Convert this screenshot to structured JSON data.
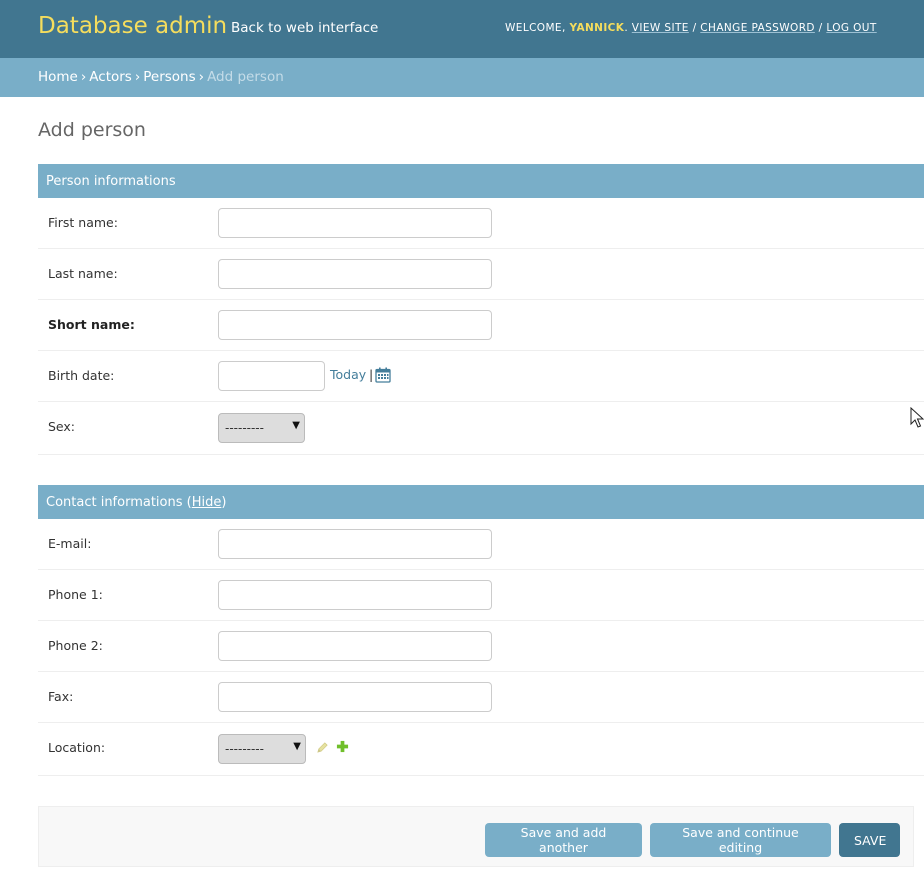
{
  "header": {
    "branding": "Database admin",
    "back_link": "Back to web interface",
    "welcome": "Welcome,",
    "username": "Yannick",
    "view_site": "View site",
    "change_password": "Change password",
    "log_out": "Log out",
    "separator": "/"
  },
  "breadcrumbs": {
    "home": "Home",
    "actors": "Actors",
    "persons": "Persons",
    "current": "Add person",
    "separator": "›"
  },
  "page_title": "Add person",
  "person_section": {
    "title": "Person informations",
    "first_name_label": "First name:",
    "last_name_label": "Last name:",
    "short_name_label": "Short name:",
    "birth_date_label": "Birth date:",
    "today_link": "Today",
    "pipe": "|",
    "sex_label": "Sex:",
    "sex_selected": "---------"
  },
  "contact_section": {
    "title": "Contact informations",
    "hide_link": "Hide",
    "email_label": "E-mail:",
    "phone1_label": "Phone 1:",
    "phone2_label": "Phone 2:",
    "fax_label": "Fax:",
    "location_label": "Location:",
    "location_selected": "---------"
  },
  "submit": {
    "save_add_another": "Save and add another",
    "save_continue": "Save and continue editing",
    "save": "Save"
  },
  "colors": {
    "header_bg": "#417690",
    "branding": "#f5dd5d",
    "breadcrumb_bg": "#79aec8",
    "module_head_bg": "#79aec8",
    "primary_button": "#417690",
    "secondary_button": "#79aec8"
  },
  "icons": {
    "calendar": "calendar-icon",
    "edit": "pencil-icon",
    "add": "plus-icon",
    "cursor": "mouse-pointer-icon"
  }
}
